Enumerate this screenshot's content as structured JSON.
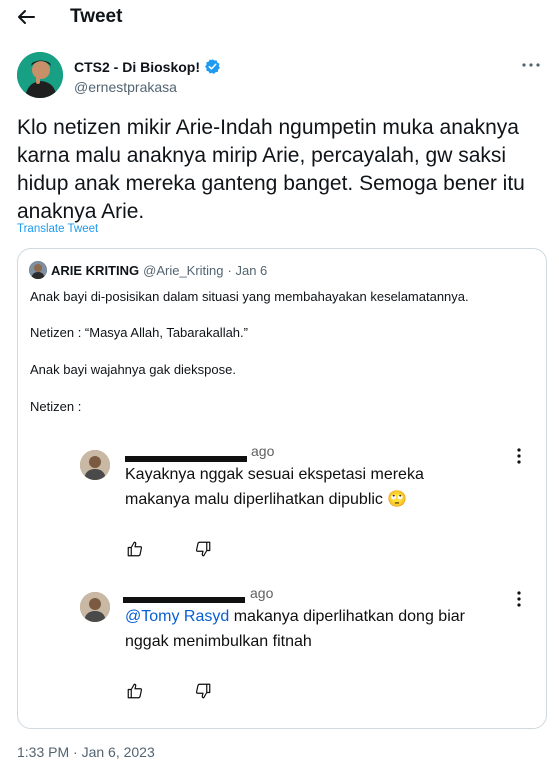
{
  "header": {
    "title": "Tweet",
    "back_icon": "arrow-left-icon"
  },
  "author": {
    "name": "CTS2 - Di Bioskop!",
    "handle": "@ernestprakasa",
    "verified": true,
    "verified_color": "#1d9bf0"
  },
  "tweet": {
    "text": "Klo netizen mikir Arie-Indah ngumpetin muka anaknya karna malu anaknya mirip Arie, percayalah, gw saksi hidup anak mereka ganteng banget. Semoga bener itu anaknya Arie.",
    "translate_label": "Translate Tweet",
    "timestamp": "1:33 PM · Jan 6, 2023"
  },
  "quote": {
    "name": "ARIE KRITING",
    "handle": "@Arie_Kriting",
    "date": "· Jan 6",
    "lines": [
      "Anak bayi di-posisikan dalam situasi yang membahayakan keselamatannya.",
      "Netizen : “Masya Allah, Tabarakallah.”",
      "Anak bayi wajahnya gak diekspose.",
      "Netizen :"
    ]
  },
  "embedded_comments": [
    {
      "time": "ago",
      "line1": "Kayaknya nggak sesuai ekspetasi mereka",
      "line2": "makanya malu diperlihatkan dipublic",
      "emoji": "🙄"
    },
    {
      "time": "ago",
      "mention": "@Tomy Rasyd",
      "line1_rest": " makanya diperlihatkan dong biar",
      "line2": "nggak menimbulkan fitnah"
    }
  ],
  "colors": {
    "accent": "#1d9bf0",
    "text": "#0f1419",
    "muted": "#536471",
    "border": "#cfd9de"
  }
}
